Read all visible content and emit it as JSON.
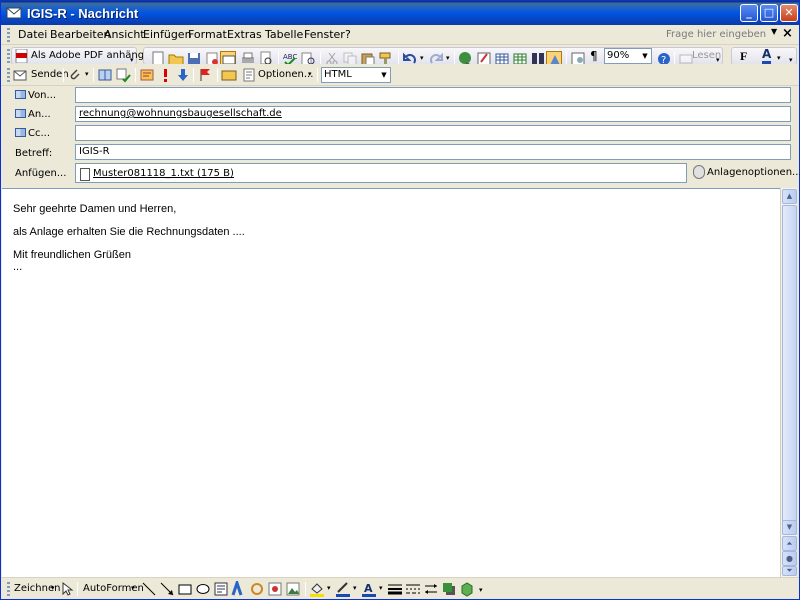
{
  "window": {
    "title": "IGIS-R - Nachricht",
    "minimize": "_",
    "maximize": "□",
    "close": "✕"
  },
  "menu": {
    "items": [
      "Datei",
      "Bearbeiten",
      "Ansicht",
      "Einfügen",
      "Format",
      "Extras",
      "Tabelle",
      "Fenster",
      "?"
    ],
    "help_placeholder": "Frage hier eingeben",
    "close_doc": "×"
  },
  "toolbar1": {
    "adobe_label": "Als Adobe PDF anhängen",
    "zoom": "90%",
    "lesen_label": "Lesen",
    "bold_label": "F",
    "font_color_label": "A",
    "paragraph_mark": "¶"
  },
  "toolbar2": {
    "send_label": "Senden",
    "options_label": "Optionen...",
    "format": "HTML"
  },
  "fields": {
    "from_label": "Von...",
    "from_value": "",
    "to_label": "An...",
    "to_value": "rechnung@wohnungsbaugesellschaft.de",
    "cc_label": "Cc...",
    "cc_value": "",
    "subject_label": "Betreff:",
    "subject_value": "IGIS-R",
    "attach_label": "Anfügen...",
    "attachment": "Muster081118_1.txt (175 B)",
    "attach_options": "Anlagenoptionen..."
  },
  "body": {
    "lines": [
      "Sehr geehrte Damen und Herren,",
      "als Anlage erhalten Sie die Rechnungsdaten ....",
      "Mit freundlichen Grüßen",
      "..."
    ]
  },
  "drawbar": {
    "draw_label": "Zeichnen",
    "autoshapes_label": "AutoFormen"
  }
}
